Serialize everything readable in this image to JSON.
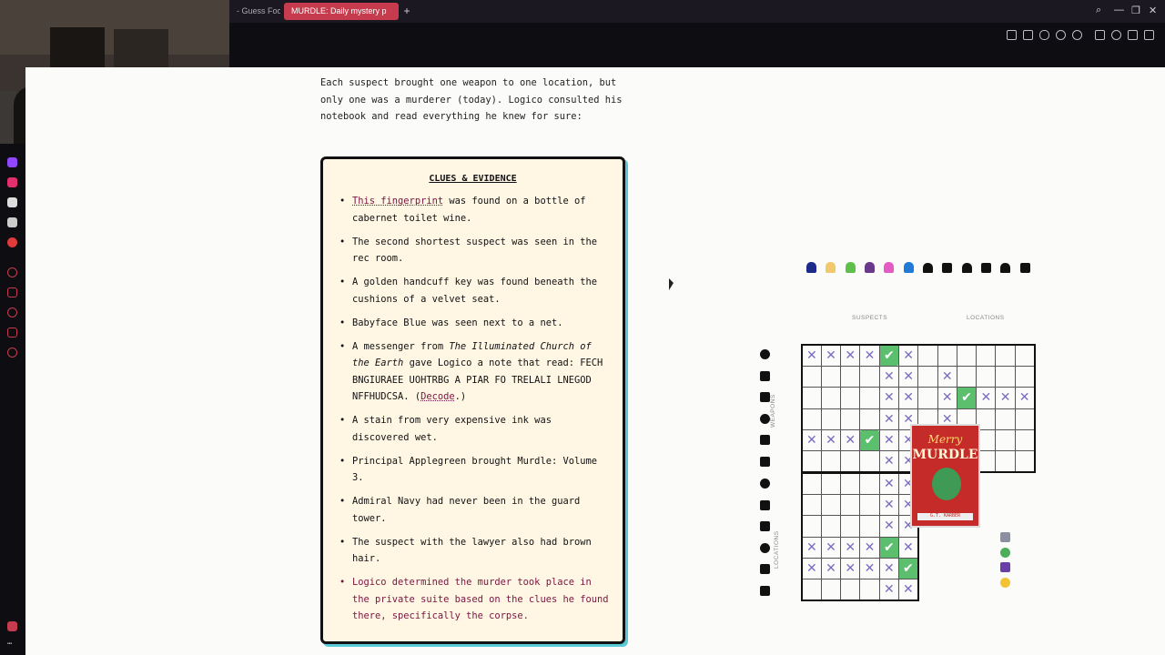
{
  "browser": {
    "tabs": [
      {
        "label": "- Guess Foo"
      },
      {
        "label": "MURDLE: Daily mystery p"
      }
    ],
    "new_tab": "+"
  },
  "intro": "Each suspect brought one weapon to one location, but only one was a murderer (today). Logico consulted his notebook and read everything he knew for sure:",
  "clues": {
    "title": "CLUES & EVIDENCE",
    "items": [
      {
        "link": "This fingerprint",
        "text": " was found on a bottle of cabernet toilet wine."
      },
      {
        "text": "The second shortest suspect was seen in the rec room."
      },
      {
        "text": "A golden handcuff key was found beneath the cushions of a velvet seat."
      },
      {
        "text": "Babyface Blue was seen next to a net."
      },
      {
        "pre": "A messenger from ",
        "em": "The Illuminated Church of the Earth",
        "post": " gave Logico a note that read: FECH BNGIURAEE UOHTRBG A PIAR FO TRELALI LNEGOD NFFHUDCSA. (",
        "link": "Decode",
        "end": ".)"
      },
      {
        "text": "A stain from very expensive ink was discovered wet."
      },
      {
        "text": "Principal Applegreen brought Murdle: Volume 3."
      },
      {
        "text": "Admiral Navy had never been in the guard tower."
      },
      {
        "text": "The suspect with the lawyer also had brown hair."
      },
      {
        "text": "Logico determined the murder took place in the private suite based on the clues he found there, specifically the corpse."
      }
    ]
  },
  "grid_labels": {
    "suspects": "SUSPECTS",
    "locations": "LOCATIONS",
    "weapons": "WEAPONS",
    "locations_side": "LOCATIONS"
  },
  "colors": {
    "accent": "#c63b4d",
    "mark_x": "#7a6cc0",
    "mark_check": "#5bbf6d",
    "card_bg": "#fff6e4",
    "card_shadow": "#59c9d6",
    "clue_red": "#7a1540"
  },
  "suspect_colors": [
    "#1e2a8a",
    "#f0c96a",
    "#5fbf4a",
    "#6a3a8a",
    "#e55bc6",
    "#1f7bd6"
  ],
  "top_grid": [
    "xxxxcx......",
    "....xx.x....",
    "....xx.xcxxxx",
    "....xx.x....",
    "xxxcxx.x....",
    "....xx.x...."
  ],
  "bottom_grid": [
    "....xx",
    "....xx",
    "....xx",
    "xxxxcx",
    "xxxxxc",
    "....xx"
  ],
  "book": {
    "script": "Merry",
    "title": "MURDLE",
    "subtitle": "25 FIENDISHLY FESTIVE LOGIC PUZZLES",
    "author": "G.T. KARBER"
  }
}
